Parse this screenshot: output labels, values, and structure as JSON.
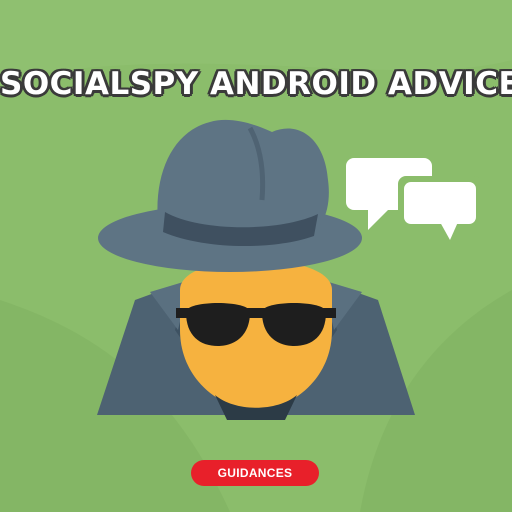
{
  "title": "SOCIALSPY ANDROID ADVICE",
  "badge_label": "GUIDANCES",
  "icons": [
    "spy-icon",
    "chat-bubble-icon",
    "chat-bubble-icon"
  ],
  "colors": {
    "background": "#8bbd6b",
    "hat": "#5e7484",
    "coat": "#4d6272",
    "face": "#f6b23f",
    "glasses": "#1e1e1e",
    "badge": "#e8202a",
    "bubble": "#ffffff"
  }
}
